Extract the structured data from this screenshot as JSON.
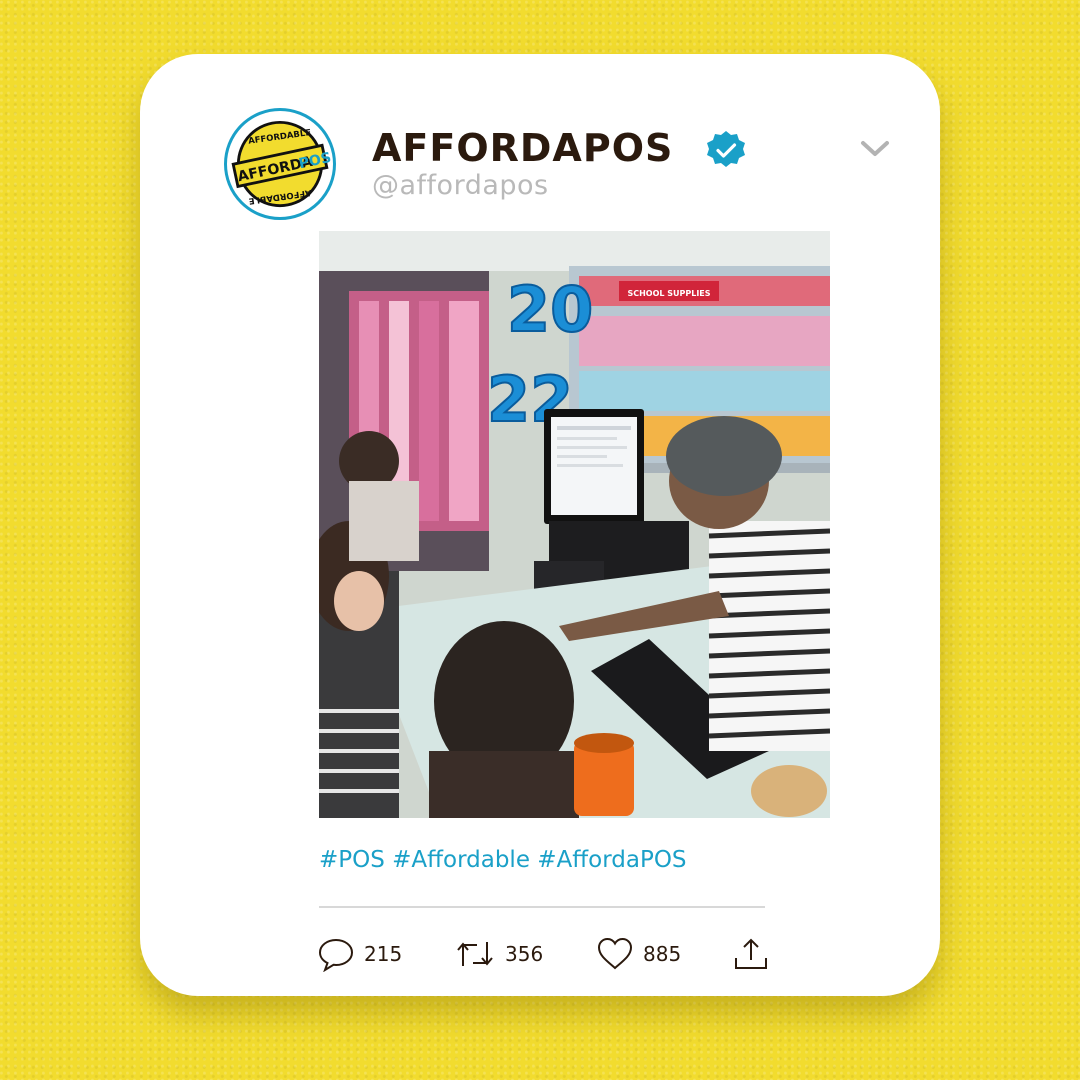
{
  "post": {
    "display_name": "AFFORDAPOS",
    "handle": "@affordapos",
    "hashtags": "#POS #Affordable #AffordaPOS",
    "avatar_logo": {
      "top_text": "AFFORDABLE",
      "main_text_1": "AFFORDA",
      "main_text_2": "POS",
      "bottom_text": "AFFORDABLE"
    },
    "photo_scene": {
      "balloon_year_top": "20",
      "balloon_year_bottom": "22",
      "shelf_sign": "SCHOOL SUPPLIES"
    }
  },
  "actions": {
    "reply_count": "215",
    "retweet_count": "356",
    "like_count": "885"
  },
  "icons": {
    "verified": "verified-badge-icon",
    "menu": "chevron-down-icon",
    "reply": "speech-bubble-icon",
    "retweet": "retweet-arrows-icon",
    "like": "heart-icon",
    "share": "share-upload-icon"
  },
  "colors": {
    "background": "#f2dc2e",
    "card": "#ffffff",
    "name": "#2b1a0e",
    "handle": "#b9b9b9",
    "accent": "#1aa0c8"
  }
}
